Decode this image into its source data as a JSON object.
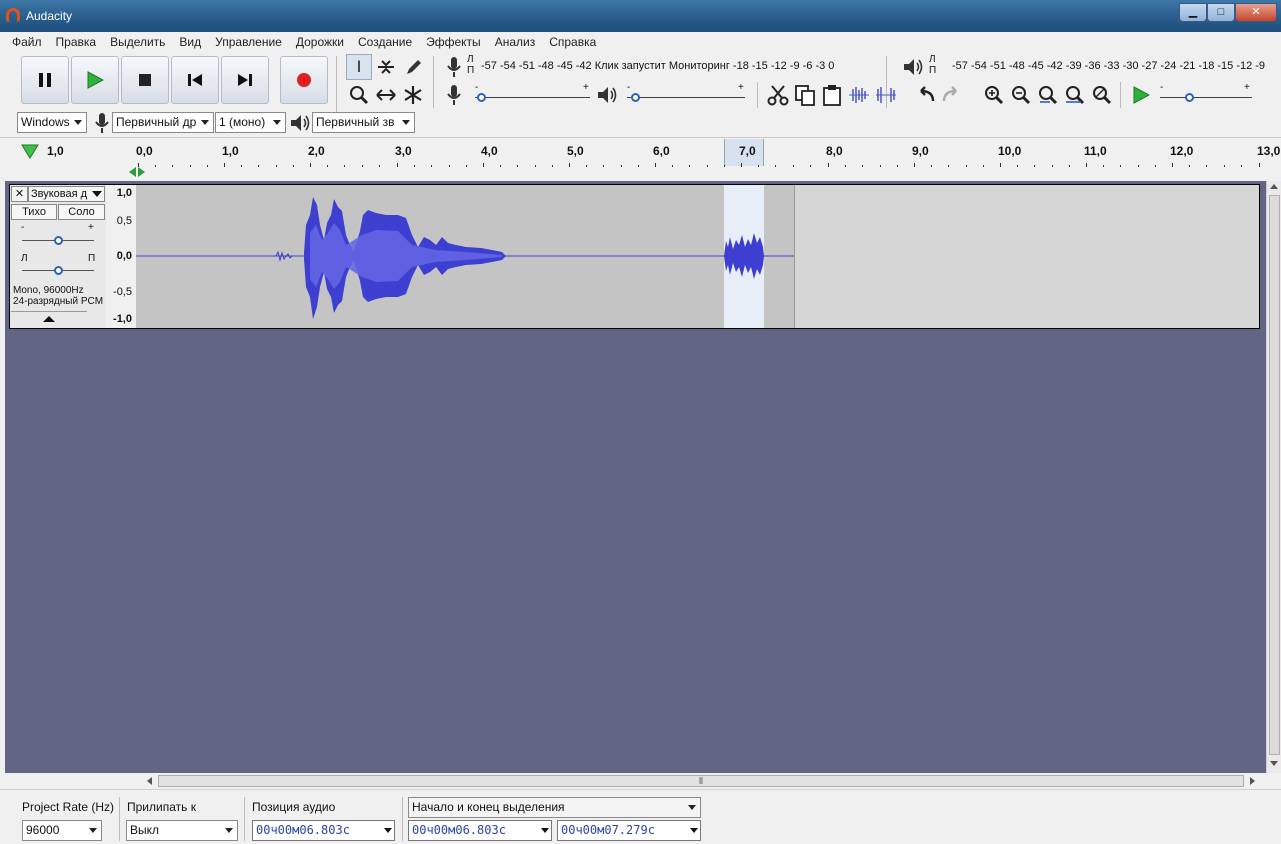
{
  "window": {
    "title": "Audacity",
    "buttons": {
      "minimize": "▁",
      "maximize": "□",
      "close": "✕"
    }
  },
  "menu": [
    "Файл",
    "Правка",
    "Выделить",
    "Вид",
    "Управление",
    "Дорожки",
    "Создание",
    "Эффекты",
    "Анализ",
    "Справка"
  ],
  "meters": {
    "record_channels": [
      "Л",
      "П"
    ],
    "record_scale": "-57 -54 -51 -48 -45 -42",
    "record_hint": "Клик запустит Мониторинг",
    "record_scale_tail": "-18 -15 -12  -9  -6  -3  0",
    "play_channels": [
      "Л",
      "П"
    ],
    "play_scale": "-57 -54 -51 -48 -45 -42 -39 -36 -33 -30 -27 -24 -21 -18 -15 -12  -9",
    "slider_plus": "+",
    "slider_minus": "-"
  },
  "device": {
    "host": "Windows",
    "input": "Первичный др",
    "channels": "1 (моно)",
    "output": "Первичный зв"
  },
  "ruler": {
    "ticks": [
      "1,0",
      "0,0",
      "1,0",
      "2,0",
      "3,0",
      "4,0",
      "5,0",
      "6,0",
      "7,0",
      "8,0",
      "9,0",
      "10,0",
      "11,0",
      "12,0",
      "13,0"
    ],
    "ticks_values": [
      -1,
      0,
      1,
      2,
      3,
      4,
      5,
      6,
      7,
      8,
      9,
      10,
      11,
      12,
      13
    ]
  },
  "track": {
    "name": "Звуковая д",
    "mute": "Тихо",
    "solo": "Соло",
    "gain_minus": "-",
    "gain_plus": "+",
    "pan_left": "Л",
    "pan_right": "П",
    "gain": 0.5,
    "pan": 0.5,
    "info_line1": "Mono, 96000Hz",
    "info_line2": "24-разрядный PCM",
    "close": "✕",
    "vscale": [
      "1,0",
      "0,5",
      "0,0",
      "-0,5",
      "-1,0"
    ]
  },
  "hscroll": {
    "grip": "⦀"
  },
  "selection_bar": {
    "project_rate_label": "Project Rate (Hz)",
    "project_rate": "96000",
    "snap_label": "Прилипать к",
    "snap_value": "Выкл",
    "audio_pos_label": "Позиция аудио",
    "audio_pos": "00ч00м06.803с",
    "selection_mode": "Начало и конец выделения",
    "sel_start": "00ч00м06.803с",
    "sel_end": "00ч00м07.279с"
  },
  "colors": {
    "waveform": "#3c3fcf",
    "waveform_rms": "#6666e6",
    "track_bg": "#636585",
    "selection": "#e8eef8"
  }
}
